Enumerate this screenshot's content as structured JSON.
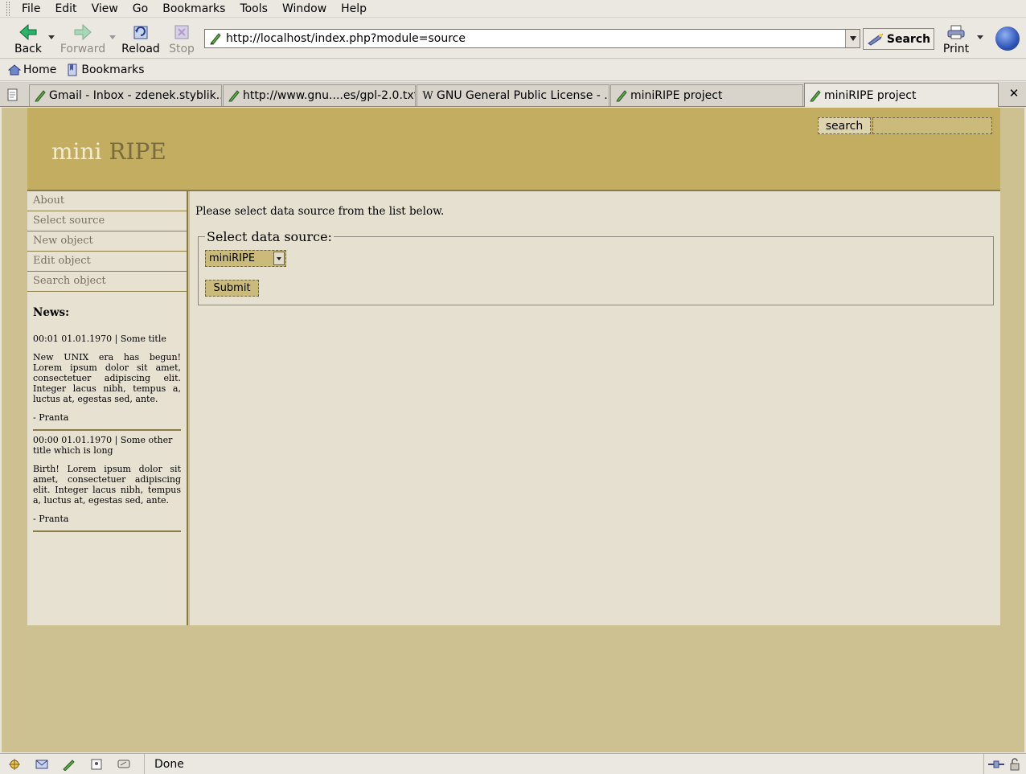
{
  "menu": [
    "File",
    "Edit",
    "View",
    "Go",
    "Bookmarks",
    "Tools",
    "Window",
    "Help"
  ],
  "toolbar": {
    "back": "Back",
    "forward": "Forward",
    "reload": "Reload",
    "stop": "Stop",
    "url": "http://localhost/index.php?module=source",
    "search": "Search",
    "print": "Print"
  },
  "personal": {
    "home": "Home",
    "bookmarks": "Bookmarks"
  },
  "tabs": [
    {
      "label": "Gmail - Inbox - zdenek.styblik...",
      "icon": "page-edit-icon"
    },
    {
      "label": "http://www.gnu....es/gpl-2.0.txt",
      "icon": "page-edit-icon"
    },
    {
      "label": "GNU General Public License - ...",
      "icon": "wikipedia-icon"
    },
    {
      "label": "miniRIPE project",
      "icon": "page-edit-icon"
    },
    {
      "label": "miniRIPE project",
      "icon": "page-edit-icon"
    }
  ],
  "site": {
    "logo_mini": "mini",
    "logo_ripe": "RIPE",
    "search_button": "search",
    "search_value": ""
  },
  "nav": [
    "About",
    "Select source",
    "New object",
    "Edit object",
    "Search object"
  ],
  "news": {
    "heading": "News:",
    "items": [
      {
        "meta": "00:01 01.01.1970 | Some title",
        "body": "New UNIX era has begun! Lorem ipsum dolor sit amet, consectetuer adipiscing elit. Integer lacus nibh, tempus a, luctus at, egestas sed, ante.",
        "author": "- Pranta"
      },
      {
        "meta": "00:00 01.01.1970 | Some other title which is long",
        "body": "Birth! Lorem ipsum dolor sit amet, consectetuer adipiscing elit. Integer lacus nibh, tempus a, luctus at, egestas sed, ante.",
        "author": "- Pranta"
      }
    ]
  },
  "main": {
    "intro": "Please select data source from the list below.",
    "legend": "Select data source:",
    "select_value": "miniRIPE",
    "submit": "Submit"
  },
  "status": {
    "text": "Done"
  },
  "colors": {
    "header": "#c2ad60",
    "background": "#cec191",
    "sidebar": "#e7e1d2",
    "content": "#e5e0d0",
    "border": "#8a7c44"
  }
}
